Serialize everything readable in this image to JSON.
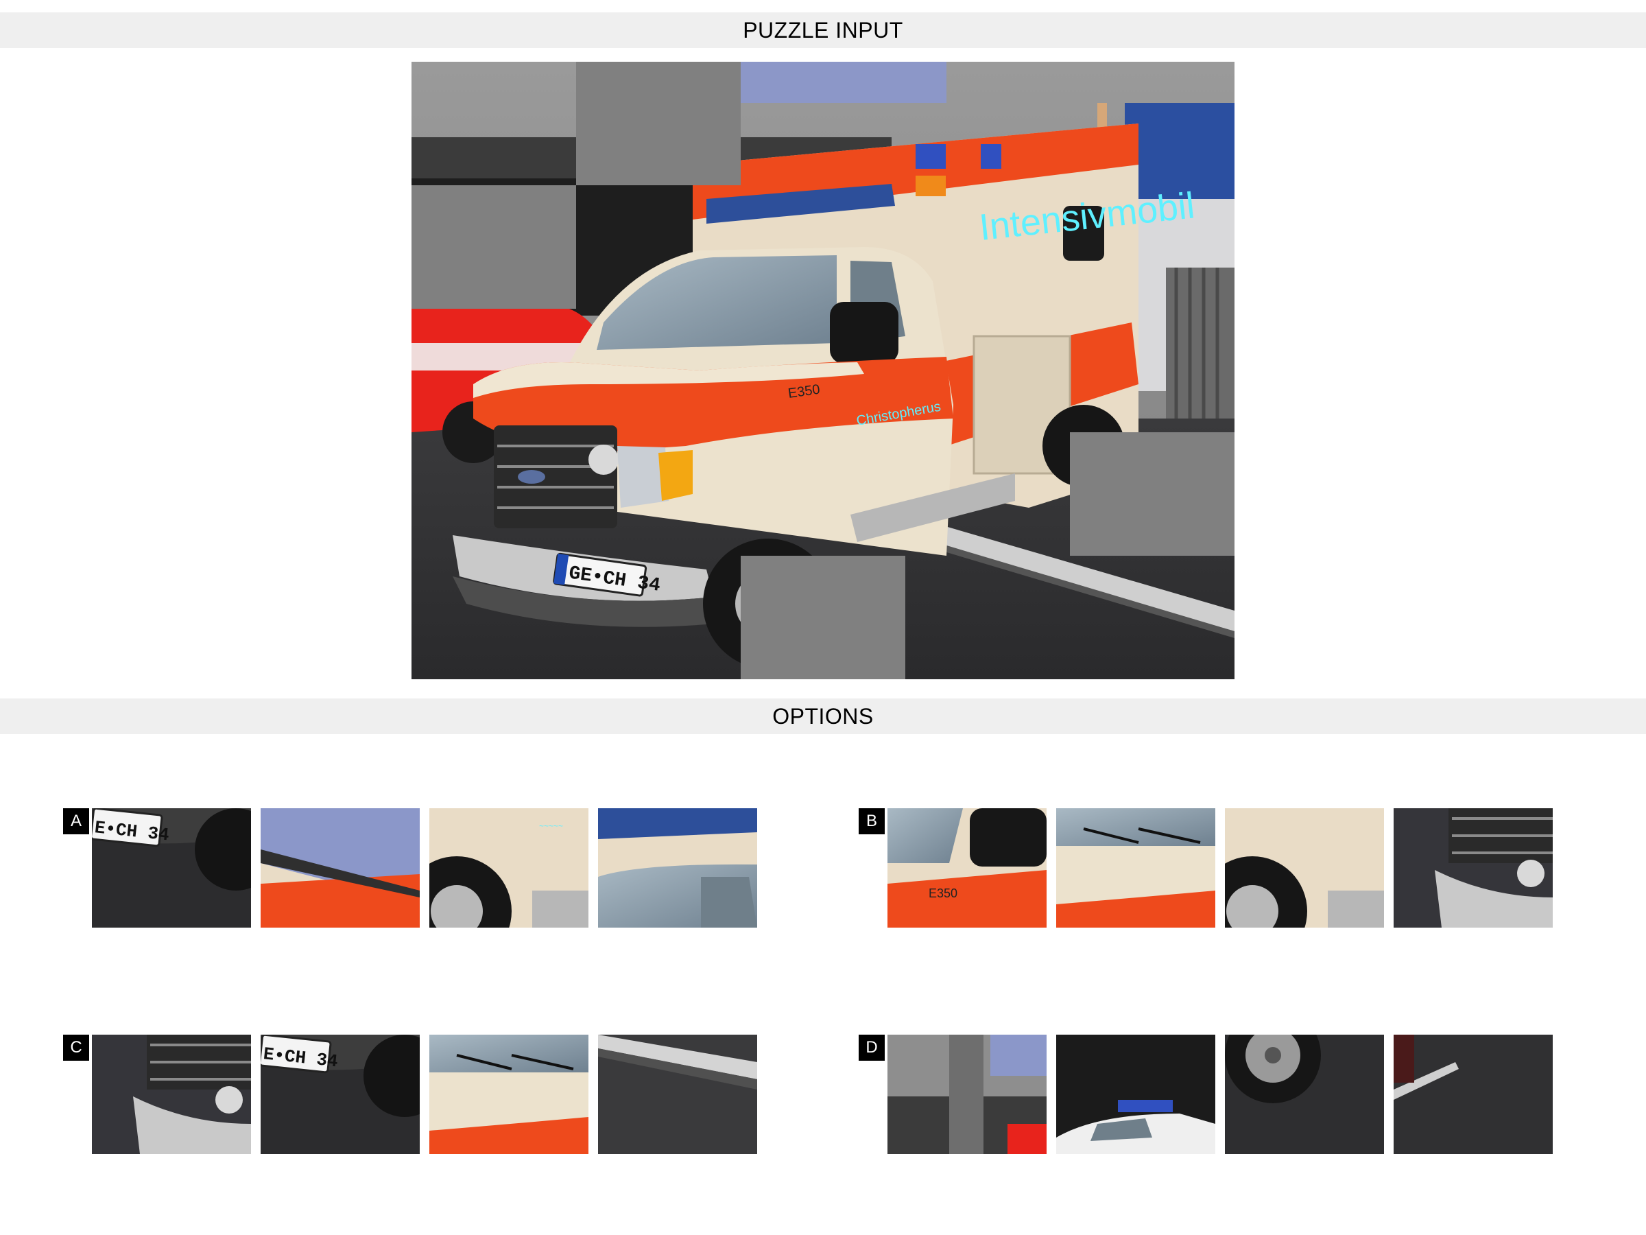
{
  "headers": {
    "input": "PUZZLE INPUT",
    "options": "OPTIONS"
  },
  "puzzle": {
    "plate_text": "GE•CH 34",
    "body_text": "Intensivmobil",
    "door_text": "Christopherus",
    "badge_text": "E350",
    "missing_tiles": 4
  },
  "options": [
    {
      "letter": "A",
      "tiles": [
        {
          "icon": "plate-tile",
          "text": "E•CH 34"
        },
        {
          "icon": "roof-stripe-tile",
          "text": ""
        },
        {
          "icon": "wheel-tile",
          "text": ""
        },
        {
          "icon": "lightbar-tile",
          "text": ""
        }
      ]
    },
    {
      "letter": "B",
      "tiles": [
        {
          "icon": "mirror-tile",
          "text": "E350"
        },
        {
          "icon": "hood-tile",
          "text": ""
        },
        {
          "icon": "wheel-tile",
          "text": ""
        },
        {
          "icon": "grille-tile",
          "text": ""
        }
      ]
    },
    {
      "letter": "C",
      "tiles": [
        {
          "icon": "grille-tile",
          "text": ""
        },
        {
          "icon": "plate-tile",
          "text": "E•CH 34"
        },
        {
          "icon": "hood-tile",
          "text": ""
        },
        {
          "icon": "drain-tile",
          "text": ""
        }
      ]
    },
    {
      "letter": "D",
      "tiles": [
        {
          "icon": "building-tile",
          "text": ""
        },
        {
          "icon": "police-car-tile",
          "text": ""
        },
        {
          "icon": "truck-wheel-tile",
          "text": ""
        },
        {
          "icon": "asphalt-tile",
          "text": ""
        }
      ]
    }
  ]
}
